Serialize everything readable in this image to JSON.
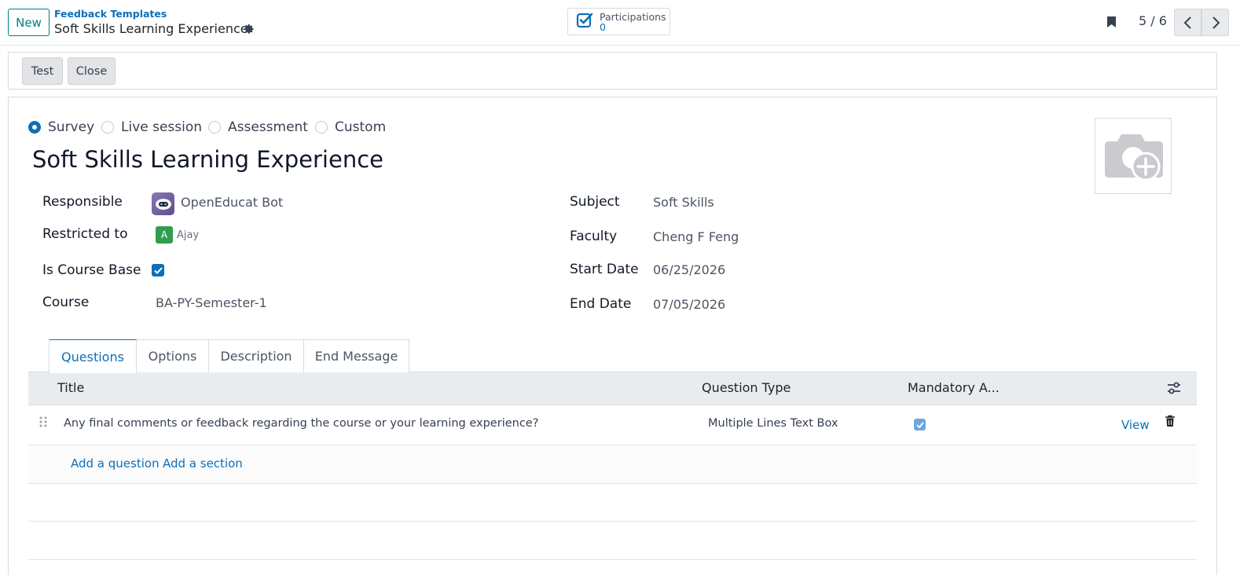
{
  "control_panel": {
    "new_label": "New",
    "breadcrumb_parent": "Feedback Templates",
    "breadcrumb_current": "Soft Skills Learning Experience",
    "stat_label": "Participations",
    "stat_value": "0",
    "pager": "5 / 6"
  },
  "status_bar": {
    "test_label": "Test",
    "close_label": "Close"
  },
  "survey_type": {
    "options": [
      "Survey",
      "Live session",
      "Assessment",
      "Custom"
    ],
    "selected": "Survey"
  },
  "record": {
    "title": "Soft Skills Learning Experience"
  },
  "fields_left": {
    "responsible_label": "Responsible",
    "responsible_value": "OpenEducat Bot",
    "restricted_label": "Restricted to",
    "restricted_initial": "A",
    "restricted_value": "Ajay",
    "course_base_label": "Is Course Base",
    "course_base_checked": true,
    "course_label": "Course",
    "course_value": "BA-PY-Semester-1"
  },
  "fields_right": {
    "subject_label": "Subject",
    "subject_value": "Soft Skills",
    "faculty_label": "Faculty",
    "faculty_value": "Cheng F Feng",
    "start_label": "Start Date",
    "start_value": "06/25/2026",
    "end_label": "End Date",
    "end_value": "07/05/2026"
  },
  "tabs": [
    "Questions",
    "Options",
    "Description",
    "End Message"
  ],
  "active_tab": "Questions",
  "questions_table": {
    "columns": [
      "Title",
      "Question Type",
      "Mandatory A..."
    ],
    "rows": [
      {
        "title": "Any final comments or feedback regarding the course or your learning experience?",
        "type": "Multiple Lines Text Box",
        "mandatory": true,
        "action": "View"
      }
    ],
    "add_question": "Add a question",
    "add_section": "Add a section"
  },
  "colors": {
    "primary": "#0d6fb8",
    "new_button": "#017e84",
    "tag_green": "#2f9e4e"
  },
  "icons": [
    "gear-icon",
    "checkbox-icon",
    "bookmark-icon",
    "chevron-left-icon",
    "chevron-right-icon",
    "camera-plus-icon",
    "drag-handle-icon",
    "trash-icon",
    "settings-sliders-icon"
  ]
}
